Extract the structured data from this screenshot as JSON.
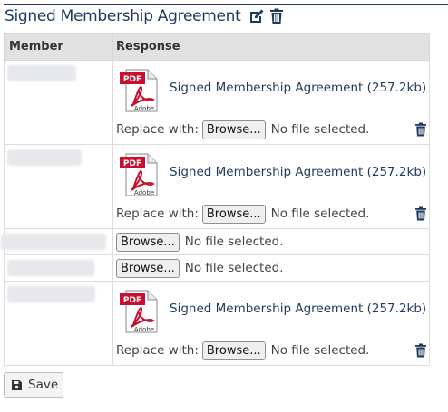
{
  "header": {
    "title": "Signed Membership Agreement",
    "edit_icon": "edit-icon",
    "delete_icon": "trash-icon"
  },
  "table": {
    "columns": [
      "Member",
      "Response"
    ],
    "rows": [
      {
        "has_file": true,
        "file_label": "Signed Membership Agreement (257.2kb)",
        "replace_label": "Replace with:",
        "browse_label": "Browse...",
        "no_file_label": "No file selected."
      },
      {
        "has_file": true,
        "file_label": "Signed Membership Agreement (257.2kb)",
        "replace_label": "Replace with:",
        "browse_label": "Browse...",
        "no_file_label": "No file selected."
      },
      {
        "has_file": false,
        "browse_label": "Browse...",
        "no_file_label": "No file selected."
      },
      {
        "has_file": false,
        "browse_label": "Browse...",
        "no_file_label": "No file selected."
      },
      {
        "has_file": true,
        "file_label": "Signed Membership Agreement (257.2kb)",
        "replace_label": "Replace with:",
        "browse_label": "Browse...",
        "no_file_label": "No file selected."
      }
    ]
  },
  "pdf_icon": {
    "badge": "PDF",
    "brand": "Adobe"
  },
  "save_button": {
    "label": "Save",
    "icon": "floppy-icon"
  },
  "colors": {
    "accent": "#1d3a5e",
    "header_bg": "#e2e2e2",
    "pdf_red": "#c8102e"
  }
}
